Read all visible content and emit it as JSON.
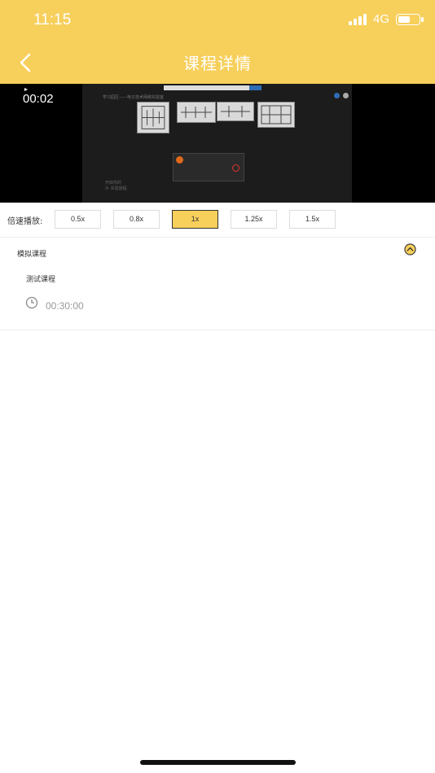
{
  "status_bar": {
    "time": "11:15",
    "network": "4G",
    "battery_level": 0.65
  },
  "header": {
    "title": "课程详情",
    "back_icon": "chevron-left-icon"
  },
  "video": {
    "current_time": "00:02",
    "screen_captions": {
      "page_heading": "学习园区——电子技术网络实验室",
      "footer_caption": "开启你的\n片 实验旅程"
    }
  },
  "speed": {
    "label": "倍速播放:",
    "options": [
      "0.5x",
      "0.8x",
      "1x",
      "1.25x",
      "1.5x"
    ],
    "selected": "1x"
  },
  "section": {
    "title": "模拟课程",
    "course_name": "测试课程",
    "duration": "00:30:00",
    "collapse_icon": "chevron-up-circle-icon",
    "clock_icon": "clock-icon"
  },
  "colors": {
    "accent": "#F7CF5B"
  }
}
